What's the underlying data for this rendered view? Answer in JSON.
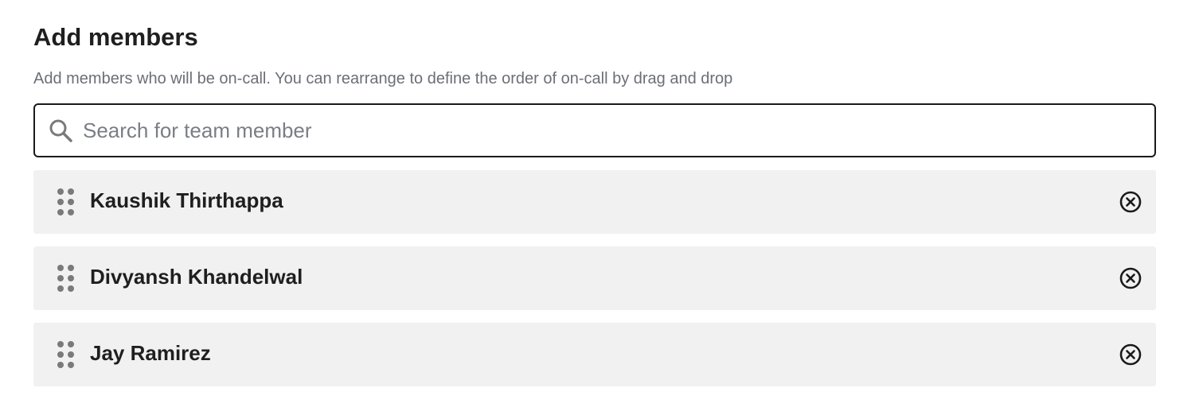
{
  "section": {
    "title": "Add members",
    "description": "Add members who will be on-call. You can rearrange to define the order of on-call by drag and drop"
  },
  "search": {
    "placeholder": "Search for team member",
    "value": "",
    "icon": "search-icon"
  },
  "members": [
    {
      "name": "Kaushik Thirthappa",
      "drag_icon": "drag-handle-icon",
      "remove_icon": "close-circle-icon"
    },
    {
      "name": "Divyansh Khandelwal",
      "drag_icon": "drag-handle-icon",
      "remove_icon": "close-circle-icon"
    },
    {
      "name": "Jay Ramirez",
      "drag_icon": "drag-handle-icon",
      "remove_icon": "close-circle-icon"
    }
  ],
  "colors": {
    "text_primary": "#1f1f1f",
    "text_secondary": "#6b6f76",
    "row_background": "#f1f1f1",
    "input_border": "#1a1a1a",
    "icon_gray": "#7a7a7a"
  }
}
